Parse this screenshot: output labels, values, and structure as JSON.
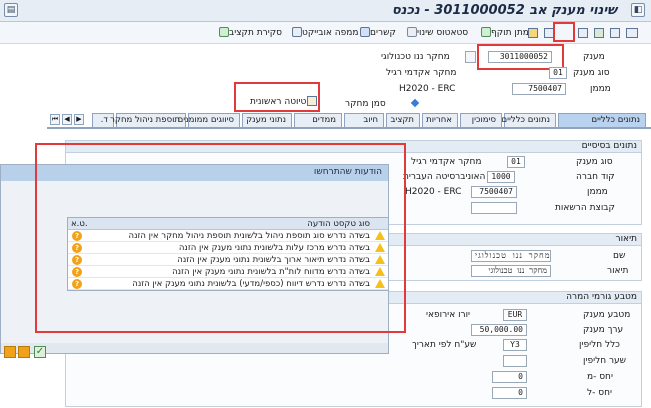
{
  "window": {
    "title": "שינוי מענק אב 3011000052 - נכנס"
  },
  "toolbar": {
    "items": [
      "מתן תוקף",
      "סטאטוס שינוי",
      "קשרים",
      "ממפה אובייקט",
      "סקירת תקציב"
    ]
  },
  "header": {
    "grant_label": "מענק",
    "grant_value": "3011000052",
    "grant_desc": "מחקר ננו טכנולוגי",
    "grant_type_label": "סוג מענק",
    "grant_type_value": "01",
    "grant_type_desc": "מחקר אקדמי רגיל",
    "funder_label": "מממן",
    "funder_value": "7500407",
    "funder_desc": "H2020 - ERC",
    "research_mark_label": "סמן מחקר",
    "first_draft_label": "טיוטה ראשונית"
  },
  "tabs": [
    {
      "label": "נתונים כלליים",
      "active": true
    },
    {
      "label": "סימוכין"
    },
    {
      "label": "אחריות"
    },
    {
      "label": "תקציב"
    },
    {
      "label": "חיוב"
    },
    {
      "label": "ממדים"
    },
    {
      "label": "נתוני מענק"
    },
    {
      "label": "סיווגים ממומנים"
    },
    {
      "label": "תוספת ניהול מחקר"
    },
    {
      "label": "ד."
    }
  ],
  "basic_data": {
    "title": "נתונים בסיסיים",
    "grant_type_label": "סוג מענק",
    "grant_type_value": "01",
    "grant_type_desc": "מחקר אקדמי רגיל",
    "company_code_label": "קוד חברה",
    "company_code_value": "1000",
    "company_code_desc": "האוניברסיטה העברית",
    "funder_label": "מממן",
    "funder_value": "7500407",
    "funder_desc": "H2020 - ERC",
    "auth_group_label": "קבוצת הרשאות"
  },
  "description": {
    "title": "תיאור",
    "name_label": "שם",
    "name_value": "מחקר ננו טכנולוגי",
    "desc_label": "תיאור",
    "desc_value": "מחקר ננו טכנולוגי"
  },
  "currency": {
    "title": "מטבע גורמי המרה",
    "grant_currency_label": "מטבע מענק",
    "grant_currency_value": "EUR",
    "grant_currency_desc": "יורו אירופאי",
    "grant_value_label": "ערך מענק",
    "grant_value_value": "50,000.00",
    "exchange_rule_label": "כלל חליפין",
    "exchange_rule_value": "Y3",
    "exchange_rule_desc": "שע\"ח לפי תאריך",
    "rate_type_label": "שער חליפין",
    "ratio_m_label": "יחס -מ",
    "ratio_m_value": "0",
    "ratio_l_label": "יחס -ל",
    "ratio_l_value": "0"
  },
  "dialog": {
    "title": "הודעות שהתרחשו",
    "col_type": "סוג טקסט הודעה",
    "col_ta": "ט.א.",
    "messages": [
      "בשדה נדרש סוג תוספת ניהול בלשונית תוספת ניהול מחקר אין הזנה",
      "בשדה נדרש מרכז עלות בלשונית נתוני מענק אין הזנה",
      "בשדה נדרש תיאור ארוך בלשונית נתוני מענק אין הזנה",
      "בשדה נדרש מדווח לות\"ת בלשונית נתוני מענק אין הזנה",
      "בשדה נדרש נדרש דיווח (כספי/מדעי) בלשונית נתוני מענק אין הזנה"
    ]
  }
}
